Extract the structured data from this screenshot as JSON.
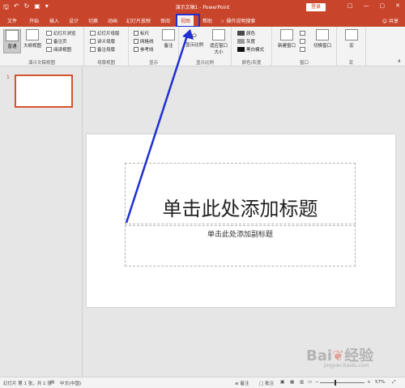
{
  "app": {
    "title": "演示文稿1 - PowerPoint",
    "login_label": "登录",
    "quick_access": [
      "save-icon",
      "undo-icon",
      "redo-icon",
      "present-icon"
    ],
    "window_controls": [
      "restore-ribbon-icon",
      "minimize-icon",
      "maximize-icon",
      "close-icon"
    ]
  },
  "tabs": [
    "文件",
    "开始",
    "插入",
    "设计",
    "切换",
    "动画",
    "幻灯片放映",
    "审阅",
    "视图",
    "帮助"
  ],
  "active_tab_index": 8,
  "tell_me": "操作说明搜索",
  "share": "共享",
  "ribbon": {
    "groups": {
      "presentation_views": {
        "label": "演示文稿视图",
        "big_buttons": [
          "普通",
          "大纲视图"
        ],
        "small_buttons": [
          "幻灯片浏览",
          "备注页",
          "阅读视图"
        ]
      },
      "master_views": {
        "label": "母版视图",
        "small_buttons": [
          "幻灯片母版",
          "讲义母版",
          "备注母版"
        ]
      },
      "show": {
        "label": "显示",
        "checkboxes": [
          "标尺",
          "网格线",
          "参考线"
        ],
        "notes_button": "备注"
      },
      "zoom": {
        "label": "显示比例",
        "buttons": [
          "显示比例",
          "适应窗口大小"
        ]
      },
      "color": {
        "label": "颜色/灰度",
        "options": [
          "颜色",
          "灰度",
          "黑白模式"
        ]
      },
      "window": {
        "label": "窗口",
        "buttons": [
          "新建窗口",
          "切换窗口"
        ]
      },
      "macros": {
        "label": "宏",
        "buttons": [
          "宏"
        ]
      }
    }
  },
  "thumbnail": {
    "number": "1"
  },
  "slide": {
    "title_placeholder": "单击此处添加标题",
    "subtitle_placeholder": "单击此处添加副标题"
  },
  "status_bar": {
    "slide_info": "幻灯片 第 1 张，共 1 张",
    "language": "中文(中国)",
    "notes": "备注",
    "comments": "批注",
    "zoom_percent": "57%"
  },
  "watermark": {
    "text": "Bai 经验",
    "sub": "jingyan.baidu.com"
  },
  "colors": {
    "brand": "#c8442a",
    "annotation": "#1f2fd1"
  }
}
